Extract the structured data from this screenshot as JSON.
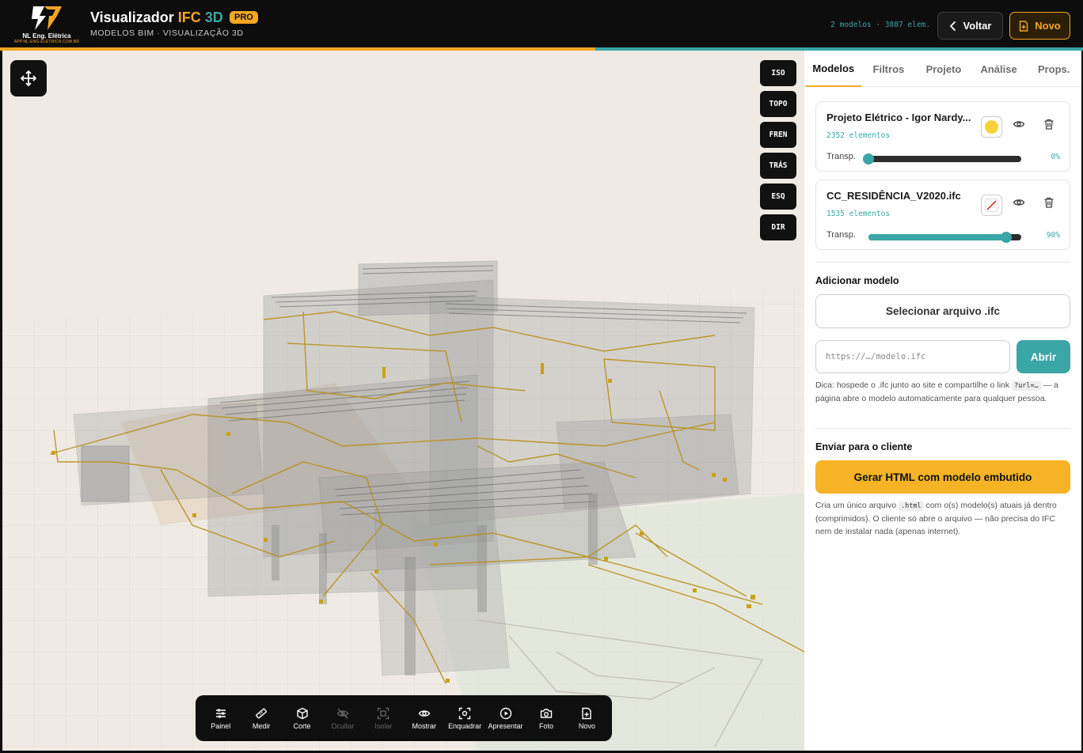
{
  "header": {
    "logo_title": "NL Eng. Elétrica",
    "logo_url": "APP.NL-ENG-ELETRICA.COM.BR",
    "title_prefix": "Visualizador",
    "title_ifc": "IFC",
    "title_3d": "3D",
    "badge": "PRO",
    "subtitle": "MODELOS BIM · VISUALIZAÇÃO 3D",
    "stats": "2 modelos · 3887 elem.",
    "back_label": "Voltar",
    "new_label": "Novo"
  },
  "progress": {
    "fraction": 0.55
  },
  "viewport": {
    "view_buttons": [
      "ISO",
      "TOPO",
      "FREN",
      "TRÁS",
      "ESQ",
      "DIR"
    ],
    "toolbar": [
      {
        "label": "Painel",
        "icon": "sliders-icon",
        "enabled": true
      },
      {
        "label": "Medir",
        "icon": "ruler-icon",
        "enabled": true
      },
      {
        "label": "Corte",
        "icon": "cube-icon",
        "enabled": true
      },
      {
        "label": "Ocultar",
        "icon": "eye-off-icon",
        "enabled": false
      },
      {
        "label": "Isolar",
        "icon": "focus-icon",
        "enabled": false
      },
      {
        "label": "Mostrar",
        "icon": "eye-icon",
        "enabled": true
      },
      {
        "label": "Enquadrar",
        "icon": "frame-icon",
        "enabled": true
      },
      {
        "label": "Apresentar",
        "icon": "play-icon",
        "enabled": true
      },
      {
        "label": "Foto",
        "icon": "camera-icon",
        "enabled": true
      },
      {
        "label": "Novo",
        "icon": "file-plus-icon",
        "enabled": true
      }
    ]
  },
  "panel": {
    "tabs": [
      "Modelos",
      "Filtros",
      "Projeto",
      "Análise",
      "Props."
    ],
    "active_tab": "Modelos",
    "models": [
      {
        "name": "Projeto Elétrico - Igor Nardy...",
        "count": "2352 elementos",
        "swatch": "#f7d23a",
        "transp_label": "Transp.",
        "transp_value": "0%",
        "transp_fraction": 0.0
      },
      {
        "name": "CC_RESIDÊNCIA_V2020.ifc",
        "count": "1535 elementos",
        "swatch": "none",
        "transp_label": "Transp.",
        "transp_value": "90%",
        "transp_fraction": 0.9
      }
    ],
    "add_model": {
      "title": "Adicionar modelo",
      "file_button": "Selecionar arquivo .ifc",
      "url_placeholder": "https://…/modelo.ifc",
      "open_button": "Abrir",
      "hint_before": "Dica: hospede o .ifc junto ao site e compartilhe o link",
      "hint_code": "?url=…",
      "hint_after": "— a página abre o modelo automaticamente para qualquer pessoa."
    },
    "send": {
      "title": "Enviar para o cliente",
      "button": "Gerar HTML com modelo embutido",
      "note_before": "Cria um único arquivo",
      "note_code": ".html",
      "note_after": "com o(s) modelo(s) atuais já dentro (comprimidos). O cliente só abre o arquivo — não precisa do IFC nem de instalar nada (apenas internet)."
    }
  },
  "colors": {
    "accent": "#f5a623",
    "teal": "#3aa6a6",
    "dark": "#0d0d0d",
    "viewport_bg": "#efebe4"
  }
}
